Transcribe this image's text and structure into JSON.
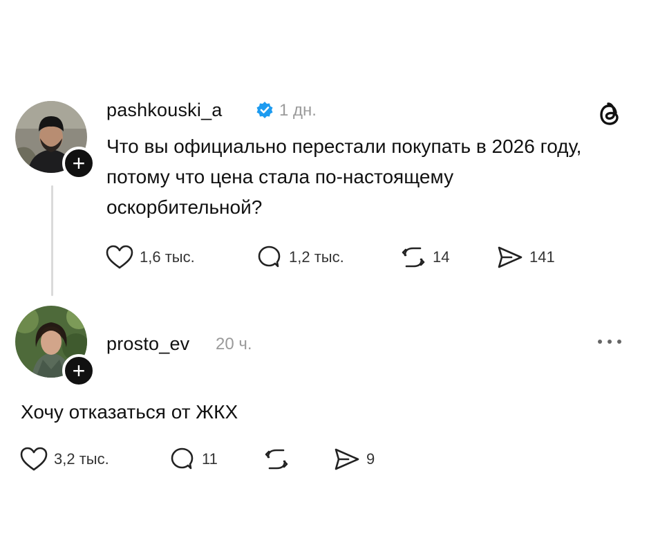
{
  "post": {
    "username": "pashkouski_a",
    "time": "1 дн.",
    "text": "Что вы официально перестали покупать в 2026 году, потому что цена стала по-настоящему оскорбительной?",
    "actions": {
      "likes": "1,6 тыс.",
      "comments": "1,2 тыс.",
      "reposts": "14",
      "shares": "141"
    }
  },
  "reply": {
    "username": "prosto_ev",
    "time": "20 ч.",
    "text": "Хочу отказаться от ЖКХ",
    "actions": {
      "likes": "3,2 тыс.",
      "comments": "11",
      "reposts": "",
      "shares": "9"
    }
  },
  "icons": {
    "verified": "verified-badge-icon",
    "app_logo": "threads-logo-icon",
    "like": "heart-icon",
    "comment": "comment-bubble-icon",
    "repost": "repost-icon",
    "share": "send-icon",
    "more": "more-dots-icon",
    "follow": "plus-icon"
  },
  "colors": {
    "verified": "#1d9bf0",
    "text": "#111111",
    "muted": "#9a9a9a",
    "thread_line": "#dadada"
  }
}
